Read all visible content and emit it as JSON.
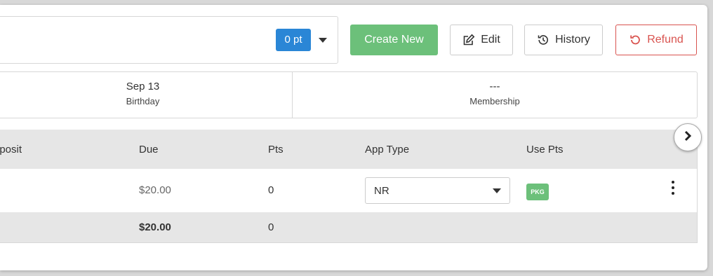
{
  "header": {
    "points_badge": "0 pt",
    "buttons": {
      "create_new": "Create New",
      "edit": "Edit",
      "history": "History",
      "refund": "Refund"
    }
  },
  "info": {
    "birthday": {
      "value": "Sep 13",
      "label": "Birthday"
    },
    "membership": {
      "value": "---",
      "label": "Membership"
    }
  },
  "table": {
    "columns": [
      "eposit",
      "Due",
      "Pts",
      "App Type",
      "Use Pts"
    ],
    "row": {
      "due": "$20.00",
      "pts": "0",
      "app_type": "NR",
      "use_pts_badge": "PKG"
    },
    "totals": {
      "due": "$20.00",
      "pts": "0"
    }
  },
  "colors": {
    "primary_blue": "#2a86d6",
    "create_green": "#6cc07a",
    "refund_red": "#d9534f"
  },
  "icons": [
    "caret-down-icon",
    "edit-icon",
    "history-icon",
    "refund-icon",
    "kebab-menu-icon",
    "chevron-right-icon"
  ]
}
